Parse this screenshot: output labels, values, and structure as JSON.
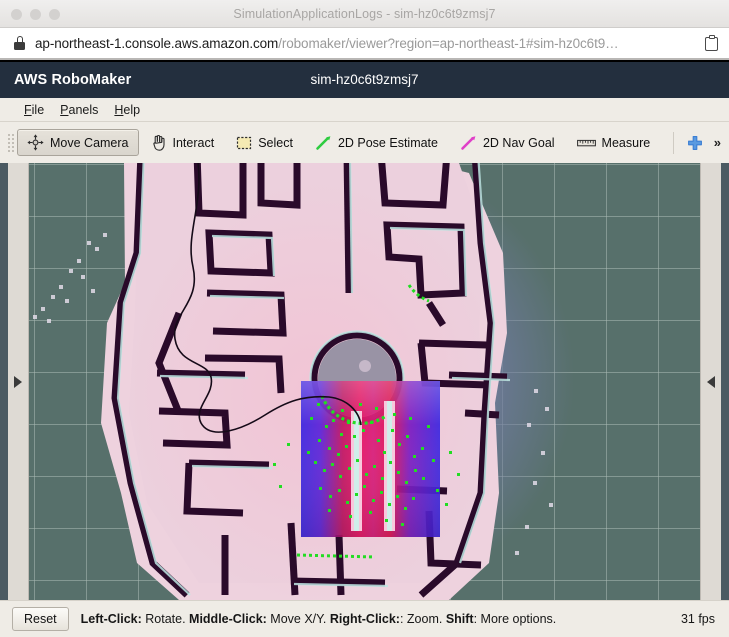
{
  "window": {
    "title": "SimulationApplicationLogs - sim-hz0c6t9zmsj7",
    "traffic_lights": [
      "close",
      "minimize",
      "zoom"
    ]
  },
  "browser": {
    "lock_icon": "lock-icon",
    "copy_icon": "clipboard-icon",
    "url_host": "ap-northeast-1.console.aws.amazon.com",
    "url_path": "/robomaker/viewer?region=ap-northeast-1#sim-hz0c6t9…"
  },
  "aws_header": {
    "brand": "AWS RoboMaker",
    "simulation_id": "sim-hz0c6t9zmsj7",
    "background": "#232f3e"
  },
  "menubar": {
    "items": [
      {
        "label": "File",
        "mnemonic": "F",
        "rest": "ile"
      },
      {
        "label": "Panels",
        "mnemonic": "P",
        "rest": "anels"
      },
      {
        "label": "Help",
        "mnemonic": "H",
        "rest": "elp"
      }
    ]
  },
  "toolbar": {
    "tools": [
      {
        "label": "Move Camera",
        "icon": "move-camera-icon",
        "checked": true
      },
      {
        "label": "Interact",
        "icon": "interact-hand-icon",
        "checked": false
      },
      {
        "label": "Select",
        "icon": "select-marquee-icon",
        "checked": false
      },
      {
        "label": "2D Pose Estimate",
        "icon": "pose-estimate-arrow-icon",
        "checked": false
      },
      {
        "label": "2D Nav Goal",
        "icon": "nav-goal-arrow-icon",
        "checked": false
      },
      {
        "label": "Measure",
        "icon": "ruler-icon",
        "checked": false
      }
    ],
    "add_tool_icon": "plus-icon",
    "overflow_label": "»",
    "accent_plus": "#3c7fd4",
    "pose_estimate_color": "#2ecc40",
    "nav_goal_color": "#e040c8"
  },
  "viewport": {
    "left_panel_toggle_icon": "expand-right-triangle-icon",
    "right_panel_toggle_icon": "expand-left-triangle-icon",
    "background_color": "#57706b",
    "grid_color": "#aab9b4",
    "grid_spacing_px": 52,
    "layers": [
      "map-occupancy-grid",
      "global-costmap-inflation",
      "local-costmap",
      "laser-scan-points",
      "global-plan-path"
    ],
    "map_free_color": "#eed2de",
    "map_wall_color": "#2a0a2a",
    "map_unknown_color": "#6f7a9e",
    "costmap_blue": "#3a24e0",
    "costmap_red": "#e01040",
    "laser_point_color": "#22dd22",
    "path_color": "#120a18"
  },
  "statusbar": {
    "reset_label": "Reset",
    "help_segments": [
      {
        "text": "Left-Click:",
        "bold": true
      },
      {
        "text": " Rotate. ",
        "bold": false
      },
      {
        "text": "Middle-Click:",
        "bold": true
      },
      {
        "text": " Move X/Y. ",
        "bold": false
      },
      {
        "text": "Right-Click:",
        "bold": true
      },
      {
        "text": ": Zoom. ",
        "bold": false
      },
      {
        "text": "Shift",
        "bold": true
      },
      {
        "text": ": More options.",
        "bold": false
      }
    ],
    "fps": "31 fps"
  }
}
